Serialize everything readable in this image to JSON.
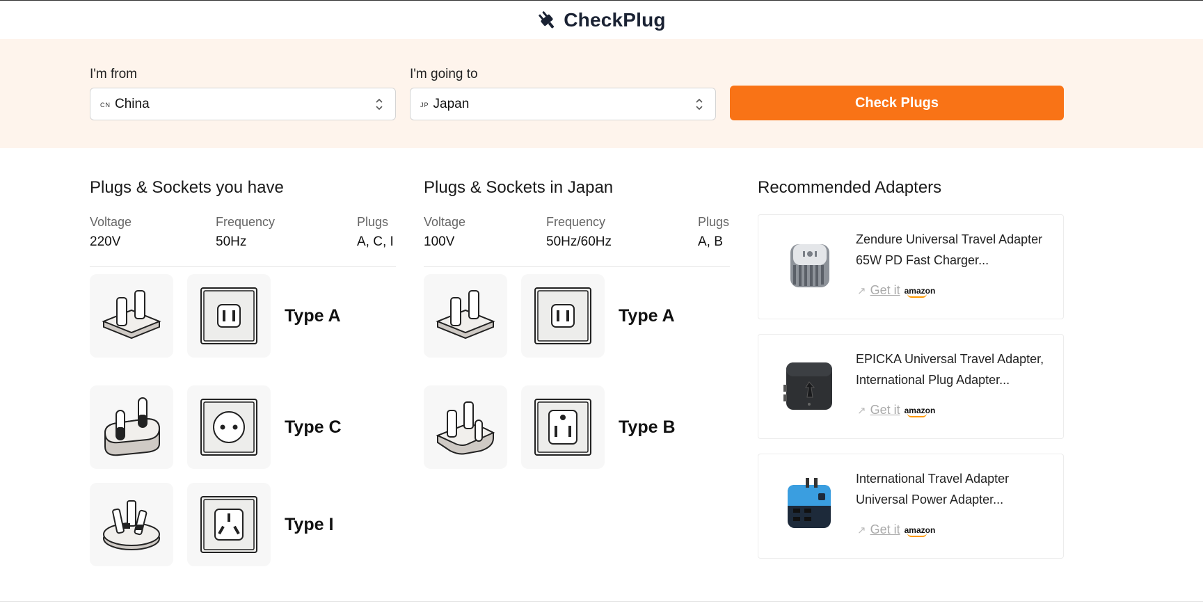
{
  "header": {
    "brand": "CheckPlug",
    "icon": "plug-icon"
  },
  "search": {
    "from_label": "I'm from",
    "from_code": "CN",
    "from_value": "China",
    "to_label": "I'm going to",
    "to_code": "JP",
    "to_value": "Japan",
    "button_label": "Check Plugs",
    "button_color": "#f97316"
  },
  "have": {
    "title": "Plugs & Sockets you have",
    "voltage_label": "Voltage",
    "voltage": "220V",
    "frequency_label": "Frequency",
    "frequency": "50Hz",
    "plugs_label": "Plugs",
    "plugs": "A, C, I",
    "types": [
      {
        "label": "Type A"
      },
      {
        "label": "Type C"
      },
      {
        "label": "Type I"
      }
    ]
  },
  "dest": {
    "title": "Plugs & Sockets in Japan",
    "voltage_label": "Voltage",
    "voltage": "100V",
    "frequency_label": "Frequency",
    "frequency": "50Hz/60Hz",
    "plugs_label": "Plugs",
    "plugs": "A, B",
    "types": [
      {
        "label": "Type A"
      },
      {
        "label": "Type B"
      }
    ]
  },
  "adapters": {
    "title": "Recommended Adapters",
    "items": [
      {
        "line1": "Zendure Universal Travel Adapter",
        "line2": "65W PD Fast Charger...",
        "link": "Get it",
        "store": "amazon"
      },
      {
        "line1": "EPICKA Universal Travel Adapter,",
        "line2": "International Plug Adapter...",
        "link": "Get it",
        "store": "amazon"
      },
      {
        "line1": "International Travel Adapter",
        "line2": "Universal Power Adapter...",
        "link": "Get it",
        "store": "amazon"
      }
    ]
  }
}
